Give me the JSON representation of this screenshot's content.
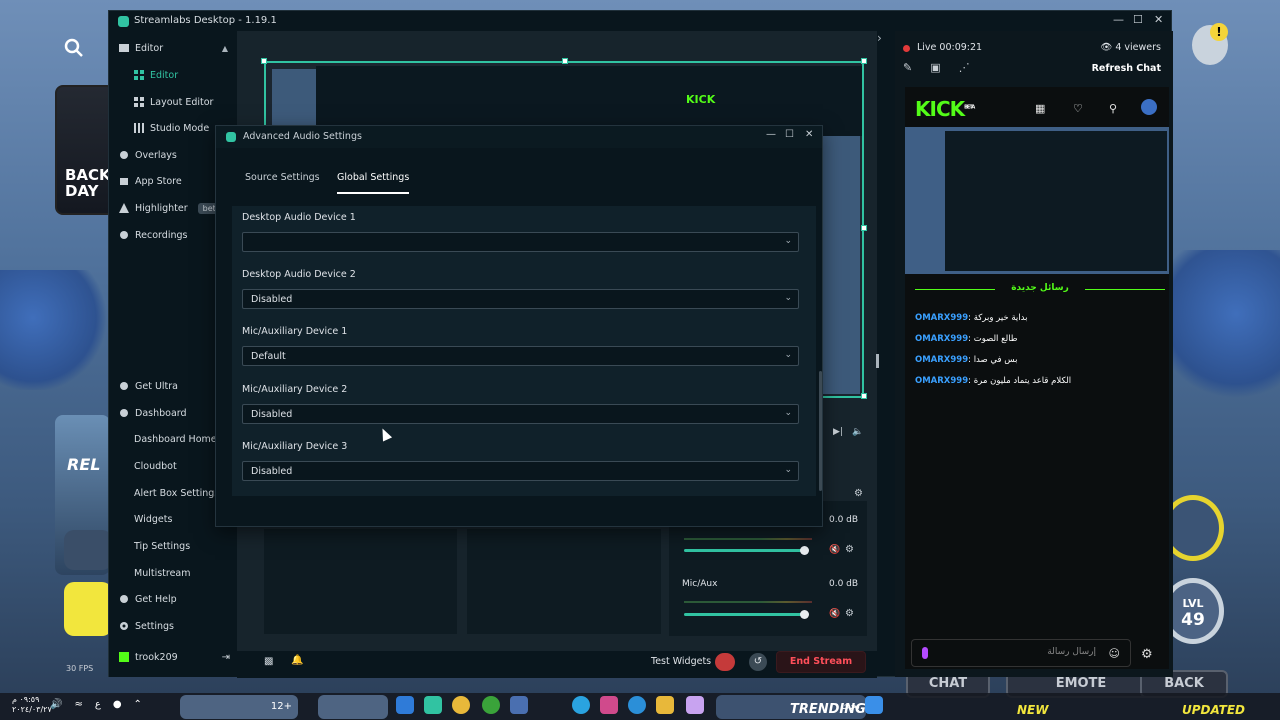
{
  "app": {
    "title": "Streamlabs Desktop - 1.19.1"
  },
  "nav": {
    "editor_group": "Editor",
    "items": [
      "Editor",
      "Layout Editor",
      "Studio Mode",
      "Overlays",
      "App Store",
      "Highlighter",
      "Recordings"
    ],
    "highlighter_badge": "beta",
    "lower": [
      "Get Ultra",
      "Dashboard",
      "Dashboard Home",
      "Cloudbot",
      "Alert Box Settings",
      "Widgets",
      "Tip Settings",
      "Multistream",
      "Get Help",
      "Settings"
    ],
    "user": "trook209"
  },
  "dialog": {
    "title": "Advanced Audio Settings",
    "tabs": [
      "Source Settings",
      "Global Settings"
    ],
    "active_tab": "Global Settings",
    "fields": [
      {
        "label": "Desktop Audio Device 1",
        "value": ""
      },
      {
        "label": "Desktop Audio Device 2",
        "value": "Disabled"
      },
      {
        "label": "Mic/Auxiliary Device 1",
        "value": "Default"
      },
      {
        "label": "Mic/Auxiliary Device 2",
        "value": "Disabled"
      },
      {
        "label": "Mic/Auxiliary Device 3",
        "value": "Disabled"
      }
    ]
  },
  "mixer": {
    "desktop_db": "0.0 dB",
    "mic_label": "Mic/Aux",
    "mic_db": "0.0 dB",
    "desktop_level": 0.95,
    "mic_level": 0.95
  },
  "footer": {
    "test_widgets": "Test Widgets",
    "end_stream": "End Stream",
    "fps": "30 FPS"
  },
  "chat": {
    "live": "Live 00:09:21",
    "viewers": "4 viewers",
    "refresh": "Refresh Chat",
    "kick_logo": "KICK",
    "kick_beta": "BETA",
    "header": "رسائل جديدة",
    "messages": [
      {
        "user": "OMARX999",
        "text": "بداية خير وبركة"
      },
      {
        "user": "OMARX999",
        "text": "طالع الصوت"
      },
      {
        "user": "OMARX999",
        "text": "بس في صدا"
      },
      {
        "user": "OMARX999",
        "text": "الكلام قاعد يتماد مليون مرة"
      }
    ],
    "input_placeholder": "إرسال رسالة"
  },
  "preview": {
    "kick_label": "KICK"
  },
  "background": {
    "char_text": "BACK DAY",
    "card_text": "REL",
    "lvl_label": "LVL",
    "lvl_value": "49",
    "buttons": [
      "CHAT",
      "EMOTE",
      "BACK"
    ],
    "alert": "!"
  },
  "taskbar": {
    "clock": "٠٩:٥٩ م",
    "date": "٢٠٢٤/٠٣/٢٧",
    "lang": "ع",
    "thumb_badge": "12+",
    "trending": "TRENDING",
    "search_label": "بحث",
    "new": "NEW",
    "updated": "UPDATED"
  }
}
